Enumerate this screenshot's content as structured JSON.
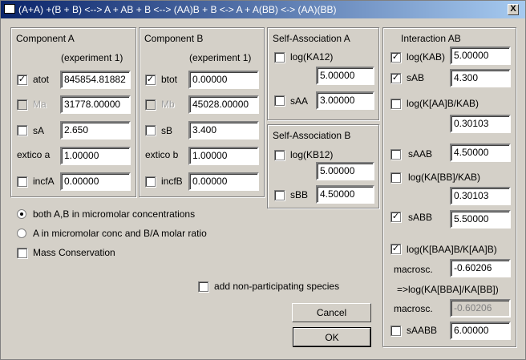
{
  "window": {
    "title": "(A+A) +(B + B) <--> A + AB + B <--> (AA)B + B <-> A + A(BB) <-> (AA)(BB)",
    "close_label": "X"
  },
  "componentA": {
    "title": "Component A",
    "experiment": "(experiment 1)",
    "atot_label": "atot",
    "atot_checked": "✓",
    "atot_value": "845854.81882",
    "ma_label": "Ma",
    "ma_value": "31778.00000",
    "sa_label": "sA",
    "sa_value": "2.650",
    "extico_label": "extico a",
    "extico_value": "1.00000",
    "incfa_label": "incfA",
    "incfa_value": "0.00000"
  },
  "componentB": {
    "title": "Component B",
    "experiment": "(experiment 1)",
    "btot_label": "btot",
    "btot_checked": "✓",
    "btot_value": "0.00000",
    "mb_label": "Mb",
    "mb_value": "45028.00000",
    "sb_label": "sB",
    "sb_value": "3.400",
    "extico_label": "extico b",
    "extico_value": "1.00000",
    "incfb_label": "incfB",
    "incfb_value": "0.00000"
  },
  "selfA": {
    "title": "Self-Association A",
    "logk_label": "log(KA12)",
    "logk_value": "5.00000",
    "saa_label": "sAA",
    "saa_value": "3.00000"
  },
  "selfB": {
    "title": "Self-Association B",
    "logk_label": "log(KB12)",
    "logk_value": "5.00000",
    "sbb_label": "sBB",
    "sbb_value": "4.50000"
  },
  "interaction": {
    "title": "Interaction AB",
    "logkab_label": "log(KAB)",
    "logkab_checked": "✓",
    "logkab_value": "5.00000",
    "sab_label": "sAB",
    "sab_checked": "✓",
    "sab_value": "4.300",
    "logkaab_label": "log(K[AA]B/KAB)",
    "logkaab_value": "0.30103",
    "saab_label": "sAAB",
    "saab_value": "4.50000",
    "logkabb_label": "log(KA[BB]/KAB)",
    "logkabb_value": "0.30103",
    "sabb_label": "sABB",
    "sabb_checked": "✓",
    "sabb_value": "5.50000",
    "logkbaa_label": "log(K[BAA]B/K[AA]B)",
    "logkbaa_checked": "✓",
    "macrosc_label": "macrosc.",
    "macrosc_value": "-0.60206",
    "derived_label": "=>log(KA[BBA]/KA[BB])",
    "macrosc2_label": "macrosc.",
    "macrosc2_value": "-0.60206",
    "saabb_label": "sAABB",
    "saabb_value": "6.00000"
  },
  "options": {
    "radio1": "both A,B in micromolar concentrations",
    "radio2": "A in micromolar conc and B/A molar ratio",
    "mass_conservation": "Mass Conservation",
    "non_participating": "add non-participating species"
  },
  "buttons": {
    "cancel": "Cancel",
    "ok": "OK"
  }
}
